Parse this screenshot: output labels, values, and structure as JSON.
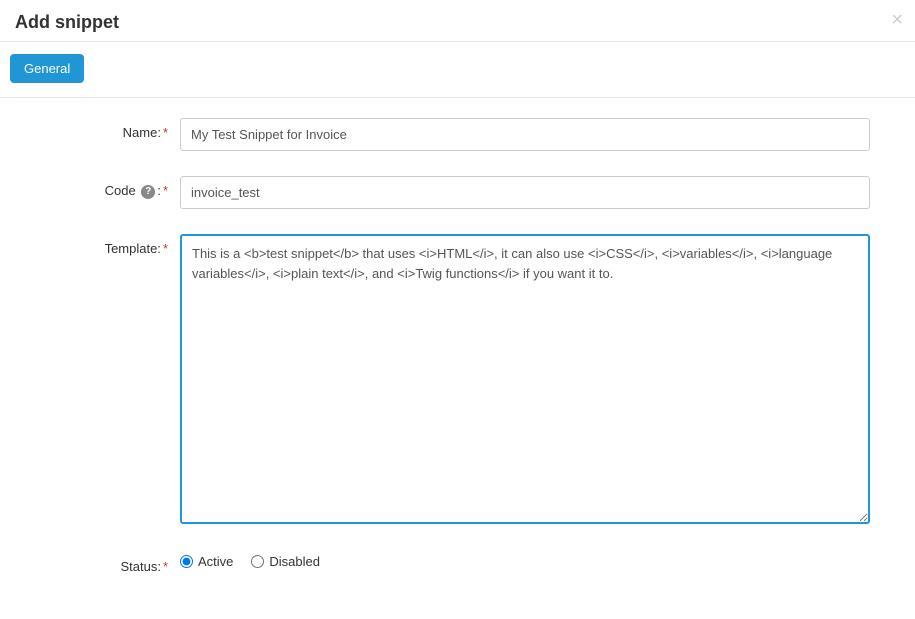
{
  "header": {
    "title": "Add snippet"
  },
  "tabs": {
    "general": "General"
  },
  "form": {
    "name": {
      "label": "Name:",
      "value": "My Test Snippet for Invoice"
    },
    "code": {
      "label": "Code",
      "value": "invoice_test",
      "colon": ":"
    },
    "template": {
      "label": "Template:",
      "value": "This is a <b>test snippet</b> that uses <i>HTML</i>, it can also use <i>CSS</i>, <i>variables</i>, <i>language variables</i>, <i>plain text</i>, and <i>Twig functions</i> if you want it to."
    },
    "status": {
      "label": "Status:",
      "active_label": "Active",
      "disabled_label": "Disabled",
      "selected": "active"
    }
  }
}
